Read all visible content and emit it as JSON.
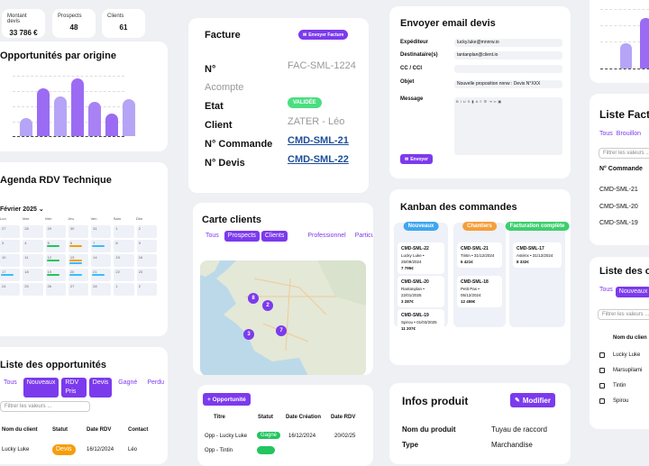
{
  "stats": [
    {
      "label": "Montant devis",
      "value": "33 786 €"
    },
    {
      "label": "Prospects",
      "value": "48"
    },
    {
      "label": "Clients",
      "value": "61"
    }
  ],
  "opp_chart": {
    "title": "Opportunités par origine",
    "chart_data": {
      "type": "bar",
      "categories": [
        "",
        "",
        "",
        "",
        "",
        "",
        ""
      ],
      "values": [
        24,
        62,
        52,
        75,
        45,
        29,
        48
      ],
      "ylim": [
        0,
        80
      ],
      "colors": [
        "#b6a4f7",
        "#9b6cf3",
        "#b6a4f7",
        "#9b6cf3",
        "#a882f5",
        "#9b6cf3",
        "#b6a4f7"
      ],
      "grid": true
    }
  },
  "agenda": {
    "title": "Agenda RDV Technique",
    "month": "Février 2025",
    "weekdays": [
      "Lun",
      "Mar",
      "Mer",
      "Jeu",
      "Ven",
      "Sam",
      "Dim"
    ],
    "weeks": [
      [
        "27",
        "28",
        "29",
        "30",
        "31",
        "1",
        "2"
      ],
      [
        "3",
        "4",
        "5",
        "6",
        "7",
        "8",
        "9"
      ],
      [
        "10",
        "11",
        "12",
        "13",
        "14",
        "15",
        "16"
      ],
      [
        "17",
        "18",
        "19",
        "20",
        "21",
        "22",
        "23"
      ],
      [
        "24",
        "25",
        "26",
        "27",
        "28",
        "1",
        "2"
      ]
    ]
  },
  "opp_list": {
    "title": "Liste des opportunités",
    "tabs": [
      "Tous",
      "Nouveaux",
      "RDV Pris",
      "Devis",
      "Gagné",
      "Perdu"
    ],
    "filter_placeholder": "Filtrer les valeurs ...",
    "columns": [
      "Nom du client",
      "Statut",
      "Date RDV",
      "Contact"
    ],
    "rows": [
      {
        "name": "Lucky Luke",
        "status": "Devis",
        "date": "16/12/2024",
        "contact": "Léo"
      }
    ]
  },
  "invoice": {
    "title": "Facture",
    "button": "Envoyer Facture",
    "fields": [
      {
        "label": "N°",
        "value": "FAC-SML-1224"
      },
      {
        "label": "Acompte",
        "value": ""
      },
      {
        "label": "Etat",
        "value": "VALIDÉE"
      },
      {
        "label": "Client",
        "value": "ZATER - Léo"
      },
      {
        "label": "N° Commande",
        "value": "CMD-SML-21"
      },
      {
        "label": "N° Devis",
        "value": "CMD-SML-22"
      }
    ]
  },
  "map": {
    "title": "Carte clients",
    "tabs": [
      "Tous",
      "Prospects",
      "Clients",
      "Professionnel",
      "Particulier"
    ],
    "markers": [
      "8",
      "2",
      "3",
      "7"
    ]
  },
  "opp_table": {
    "button": "+ Opportunité",
    "columns": [
      "Titre",
      "Statut",
      "Date Création",
      "Date RDV"
    ],
    "rows": [
      {
        "title": "Opp - Lucky Luke",
        "status": "Gagné",
        "created": "16/12/2024",
        "rdv": "20/02/25"
      },
      {
        "title": "Opp - Tintin",
        "status": "",
        "created": "",
        "rdv": ""
      }
    ]
  },
  "email": {
    "title": "Envoyer email devis",
    "labels": {
      "from": "Expéditeur",
      "to": "Destinataire(s)",
      "cc": "CC / CCI",
      "subject": "Objet",
      "message": "Message"
    },
    "from": "lucky.luke@mnnrw.io",
    "to": "tantanplan@client.io",
    "subject": "Nouvelle proposition nnnw : Devis N°XXX",
    "send": "Envoyer"
  },
  "kanban": {
    "title": "Kanban des commandes",
    "columns": [
      {
        "name": "Nouveaux",
        "color": "#3fa6f0",
        "cards": [
          {
            "id": "CMD-SML-22",
            "who": "Lucky Luke • 25/09/2024",
            "amount": "7 795€"
          },
          {
            "id": "CMD-SML-20",
            "who": "Rantanplan • 22/01/2025",
            "amount": "3 287€"
          },
          {
            "id": "CMD-SML-19",
            "who": "Spirou • 01/03/2025",
            "amount": "11 207€"
          }
        ]
      },
      {
        "name": "Chantiers",
        "color": "#f59e3b",
        "cards": [
          {
            "id": "CMD-SML-21",
            "who": "Tintin • 31/12/2024",
            "amount": "6 421€"
          },
          {
            "id": "CMD-SML-18",
            "who": "Petit Pas • 05/12/2024",
            "amount": "12 459€"
          }
        ]
      },
      {
        "name": "Facturation complète",
        "color": "#3ecf6e",
        "cards": [
          {
            "id": "CMD-SML-17",
            "who": "Astérix • 31/12/2024",
            "amount": "8 332€"
          }
        ]
      }
    ]
  },
  "product": {
    "title": "Infos produit",
    "button": "Modifier",
    "fields": [
      {
        "label": "Nom du produit",
        "value": "Tuyau de raccord"
      },
      {
        "label": "Type",
        "value": "Marchandise"
      }
    ]
  },
  "right_invoices": {
    "title": "Liste Factu",
    "tabs": [
      "Tous",
      "Brouillon"
    ],
    "filter_placeholder": "Filtrer les valeurs ...",
    "column": "N° Commande",
    "rows": [
      "CMD-SML-21",
      "CMD-SML-20",
      "CMD-SML-19"
    ]
  },
  "right_opps": {
    "title": "Liste des op",
    "tabs": [
      "Tous",
      "Nouveaux"
    ],
    "filter_placeholder": "Filtrer les valeurs ...",
    "column": "Nom du clien",
    "rows": [
      "Lucky Luke",
      "Marsupilami",
      "Tintin",
      "Spirou"
    ]
  },
  "colors": {
    "accent": "#7c3aed",
    "won": "#22c55e",
    "devis": "#f59e0b",
    "valid": "#4ade80"
  }
}
